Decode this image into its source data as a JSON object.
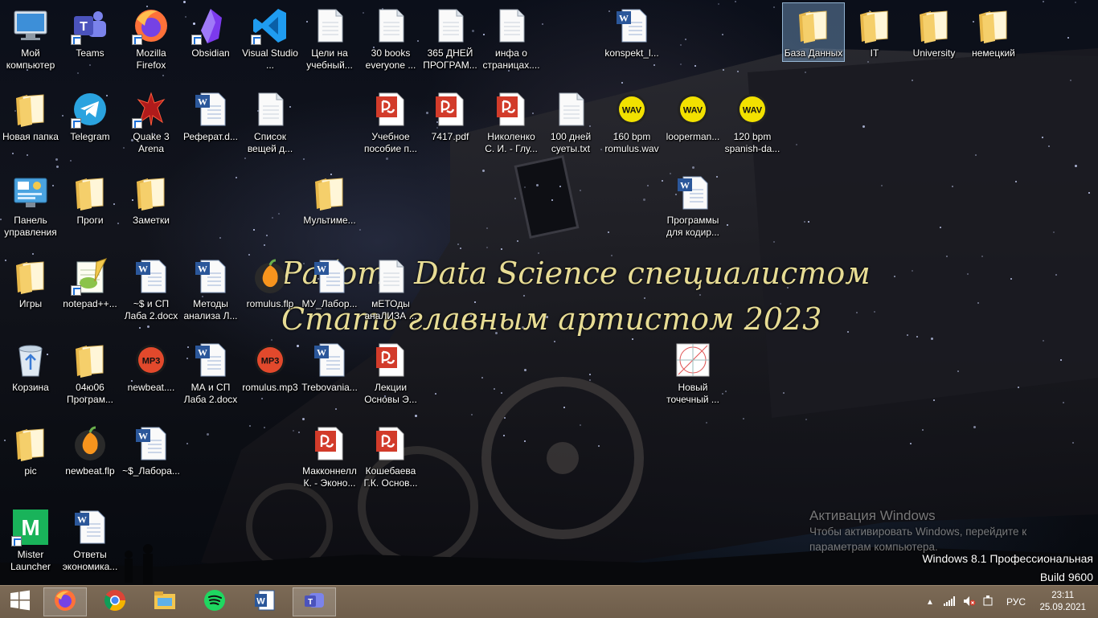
{
  "wallpaper_text": {
    "line1": "Работа Data Science специалистом",
    "line2": "Стать главным артистом 2023"
  },
  "activation": {
    "title": "Активация Windows",
    "subtitle": "Чтобы активировать Windows, перейдите к параметрам компьютера."
  },
  "os_version": {
    "line1": "Windows 8.1 Профессиональная",
    "line2": "Build 9600"
  },
  "desktop_icons": [
    {
      "label": "Мой компьютер",
      "icon": "computer-icon",
      "shortcut": false
    },
    {
      "label": "Teams",
      "icon": "teams-icon",
      "shortcut": true
    },
    {
      "label": "Mozilla Firefox",
      "icon": "firefox-icon",
      "shortcut": true
    },
    {
      "label": "Obsidian",
      "icon": "obsidian-icon",
      "shortcut": true
    },
    {
      "label": "Visual Studio ...",
      "icon": "vscode-icon",
      "shortcut": true
    },
    {
      "label": "Цели на учебный...",
      "icon": "document-icon",
      "shortcut": false
    },
    {
      "label": "30 books everyone ...",
      "icon": "document-icon",
      "shortcut": false
    },
    {
      "label": "365 ДНЕЙ ПРОГРАМ...",
      "icon": "document-icon",
      "shortcut": false
    },
    {
      "label": "инфа о страницах....",
      "icon": "document-icon",
      "shortcut": false
    },
    {
      "label": "konspekt_l...",
      "icon": "word-document-icon",
      "shortcut": false
    },
    {
      "label": "База Данных",
      "icon": "folder-icon",
      "shortcut": false,
      "selected": true
    },
    {
      "label": "IT",
      "icon": "folder-icon",
      "shortcut": false
    },
    {
      "label": "University",
      "icon": "folder-icon",
      "shortcut": false
    },
    {
      "label": "немецкий",
      "icon": "folder-icon",
      "shortcut": false
    },
    {
      "label": "Новая папка",
      "icon": "folder-icon",
      "shortcut": false
    },
    {
      "label": "Telegram",
      "icon": "telegram-icon",
      "shortcut": true
    },
    {
      "label": "Quake 3 Arena",
      "icon": "quake-icon",
      "shortcut": true
    },
    {
      "label": "Реферат.d...",
      "icon": "word-document-icon",
      "shortcut": false
    },
    {
      "label": "Список вещей д...",
      "icon": "document-icon",
      "shortcut": false
    },
    {
      "label": "Учебное пособие п...",
      "icon": "pdf-icon",
      "shortcut": false
    },
    {
      "label": "7417.pdf",
      "icon": "pdf-icon",
      "shortcut": false
    },
    {
      "label": "Николенко С. И. - Глу...",
      "icon": "pdf-icon",
      "shortcut": false
    },
    {
      "label": "100 дней суеты.txt",
      "icon": "document-icon",
      "shortcut": false
    },
    {
      "label": "160 bpm romulus.wav",
      "icon": "wav-icon",
      "shortcut": false
    },
    {
      "label": "looperman...",
      "icon": "wav-icon",
      "shortcut": false
    },
    {
      "label": "120 bpm spanish-da...",
      "icon": "wav-icon",
      "shortcut": false
    },
    {
      "label": "Панель управления",
      "icon": "control-panel-icon",
      "shortcut": false
    },
    {
      "label": "Проги",
      "icon": "folder-icon",
      "shortcut": false
    },
    {
      "label": "Заметки",
      "icon": "folder-icon",
      "shortcut": false
    },
    {
      "label": "Мультиме...",
      "icon": "folder-icon",
      "shortcut": false
    },
    {
      "label": "Программы для кодир...",
      "icon": "word-document-icon",
      "shortcut": false
    },
    {
      "label": "Игры",
      "icon": "folder-icon",
      "shortcut": false
    },
    {
      "label": "notepad++...",
      "icon": "notepadpp-icon",
      "shortcut": true
    },
    {
      "label": "~$ и СП Лаба 2.docx",
      "icon": "word-document-icon",
      "shortcut": false
    },
    {
      "label": "Методы анализа Л...",
      "icon": "word-document-icon",
      "shortcut": false
    },
    {
      "label": "romulus.flp",
      "icon": "flstudio-icon",
      "shortcut": false
    },
    {
      "label": "МУ_Лабор...",
      "icon": "word-document-icon",
      "shortcut": false
    },
    {
      "label": "мЕТОды анаЛИЗА ...",
      "icon": "document-icon",
      "shortcut": false
    },
    {
      "label": "Корзина",
      "icon": "recycle-bin-icon",
      "shortcut": false
    },
    {
      "label": "04ю06 Програм...",
      "icon": "folder-icon",
      "shortcut": false
    },
    {
      "label": "newbeat....",
      "icon": "mp3-icon",
      "shortcut": false
    },
    {
      "label": "МА и СП Лаба 2.docx",
      "icon": "word-document-icon",
      "shortcut": false
    },
    {
      "label": "romulus.mp3",
      "icon": "mp3-icon",
      "shortcut": false
    },
    {
      "label": "Trebovania...",
      "icon": "word-document-icon",
      "shortcut": false
    },
    {
      "label": "Лекции Основы Э...",
      "icon": "pdf-icon",
      "shortcut": false
    },
    {
      "label": "Новый точечный ...",
      "icon": "image-icon",
      "shortcut": false
    },
    {
      "label": "pic",
      "icon": "folder-icon",
      "shortcut": false
    },
    {
      "label": "newbeat.flp",
      "icon": "flstudio-icon",
      "shortcut": false
    },
    {
      "label": "~$_Лабора...",
      "icon": "word-document-icon",
      "shortcut": false
    },
    {
      "label": "Макконнелл К. - Эконо...",
      "icon": "pdf-icon",
      "shortcut": false
    },
    {
      "label": "Кошебаева Г.К. Основ...",
      "icon": "pdf-icon",
      "shortcut": false
    },
    {
      "label": "Mister Launcher",
      "icon": "mister-launcher-icon",
      "shortcut": true
    },
    {
      "label": "Ответы экономика...",
      "icon": "word-document-icon",
      "shortcut": false
    }
  ],
  "taskbar": {
    "start": "windows-start-icon",
    "apps": [
      {
        "name": "firefox-icon",
        "active": true
      },
      {
        "name": "chrome-icon",
        "active": false
      },
      {
        "name": "file-explorer-icon",
        "active": false
      },
      {
        "name": "spotify-icon",
        "active": false
      },
      {
        "name": "word-icon",
        "active": false
      },
      {
        "name": "teams-icon",
        "active": true
      }
    ],
    "tray": {
      "language": "РУС",
      "time": "23:11",
      "date": "25.09.2021"
    }
  },
  "colors": {
    "taskbar": "#76644f",
    "wallpaper_text": "#f3e79b",
    "folder": "#f1c65b",
    "pdf": "#d23b2a"
  }
}
